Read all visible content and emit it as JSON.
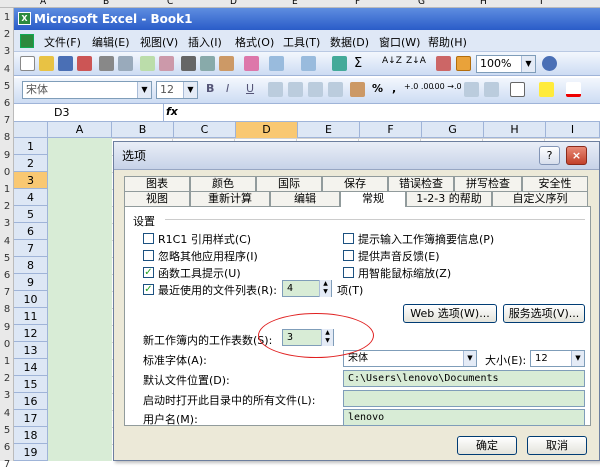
{
  "outer": {
    "col_a": "A",
    "col_b": "B",
    "col_c": "C",
    "col_d": "D",
    "col_e": "E",
    "col_f": "F",
    "col_g": "G",
    "col_h": "H",
    "col_i": "I",
    "rows": [
      "1",
      "2",
      "3",
      "4",
      "5",
      "6",
      "7",
      "8",
      "9",
      "0",
      "1",
      "2",
      "3",
      "4",
      "5",
      "6",
      "7",
      "8",
      "9",
      "0",
      "1",
      "2",
      "3",
      "4",
      "5",
      "6",
      "7"
    ]
  },
  "window": {
    "title": "Microsoft Excel - Book1",
    "icon_letter": "X"
  },
  "menu": {
    "items": [
      "文件(F)",
      "编辑(E)",
      "视图(V)",
      "插入(I)",
      "格式(O)",
      "工具(T)",
      "数据(D)",
      "窗口(W)",
      "帮助(H)"
    ]
  },
  "toolbar": {
    "zoom": "100%",
    "font_name": "宋体",
    "font_size": "12",
    "bold": "B",
    "italic": "I",
    "underline": "U",
    "percent": "%",
    "comma": ",",
    "inc_decimal": "+.0 .00",
    "dec_decimal": ".00 →.0",
    "sort_az": "A↓Z",
    "sort_za": "Z↓A",
    "sigma": "Σ"
  },
  "formula_bar": {
    "name_box": "D3",
    "fx": "fx"
  },
  "sheet": {
    "columns": [
      "A",
      "B",
      "C",
      "D",
      "E",
      "F",
      "G",
      "H",
      "I"
    ],
    "rows": [
      "1",
      "2",
      "3",
      "4",
      "5",
      "6",
      "7",
      "8",
      "9",
      "10",
      "11",
      "12",
      "13",
      "14",
      "15",
      "16",
      "17",
      "18",
      "19"
    ]
  },
  "dialog": {
    "title": "选项",
    "help_button": "?",
    "close_button": "×",
    "tabs_row1": [
      "图表",
      "颜色",
      "国际",
      "保存",
      "错误检查",
      "拼写检查",
      "安全性"
    ],
    "tabs_row2": [
      "视图",
      "重新计算",
      "编辑",
      "常规",
      "1-2-3 的帮助",
      "自定义序列"
    ],
    "active_tab": "常规",
    "section_title": "设置",
    "left_options": [
      {
        "label": "R1C1 引用样式(C)",
        "checked": false
      },
      {
        "label": "忽略其他应用程序(I)",
        "checked": false
      },
      {
        "label": "函数工具提示(U)",
        "checked": true
      },
      {
        "label": "最近使用的文件列表(R):",
        "checked": true
      }
    ],
    "right_options": [
      {
        "label": "提示输入工作簿摘要信息(P)",
        "checked": false
      },
      {
        "label": "提供声音反馈(E)",
        "checked": false
      },
      {
        "label": "用智能鼠标缩放(Z)",
        "checked": false
      }
    ],
    "recent_count": "4",
    "recent_unit": "项(T)",
    "web_options_button": "Web 选项(W)...",
    "service_options_button": "服务选项(V)...",
    "sheets_label": "新工作簿内的工作表数(S):",
    "sheets_value": "3",
    "std_font_label": "标准字体(A):",
    "std_font_value": "宋体",
    "size_label": "大小(E):",
    "size_value": "12",
    "default_location_label": "默认文件位置(D):",
    "default_location_value": "C:\\Users\\lenovo\\Documents",
    "startup_label": "启动时打开此目录中的所有文件(L):",
    "startup_value": "",
    "username_label": "用户名(M):",
    "username_value": "lenovo",
    "ok_button": "确定",
    "cancel_button": "取消"
  }
}
